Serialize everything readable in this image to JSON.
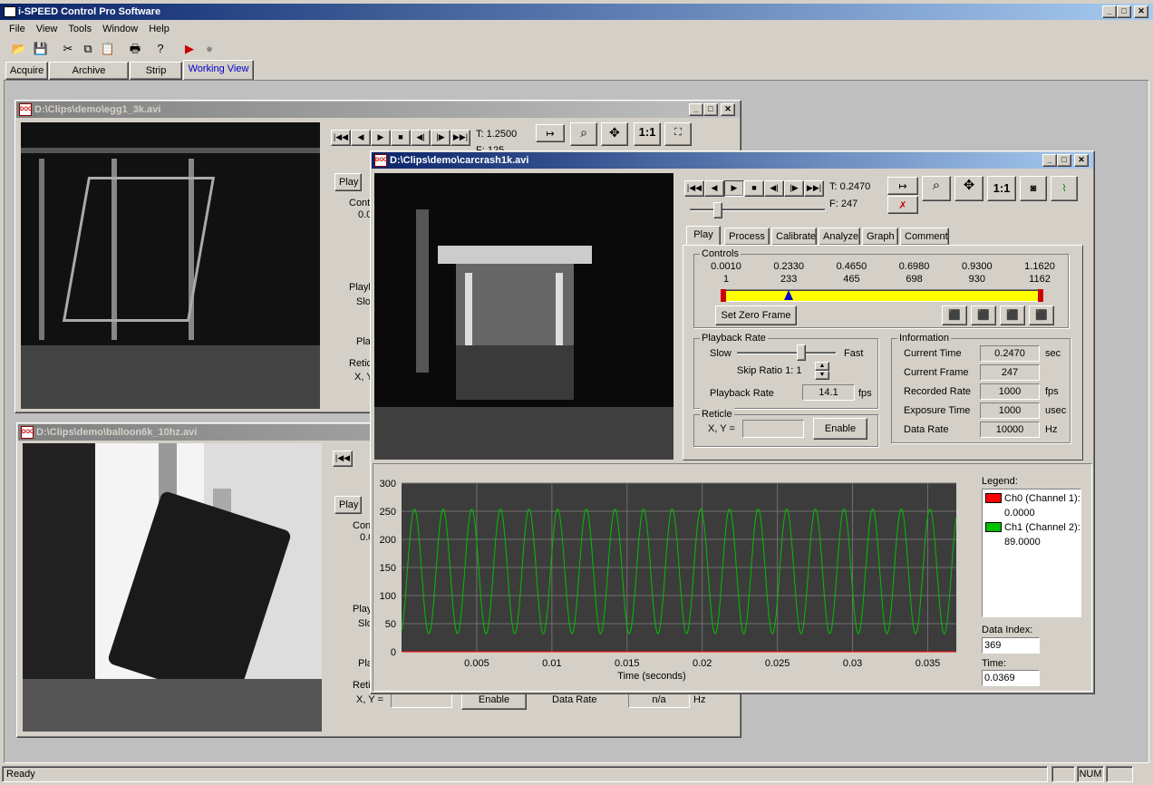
{
  "app": {
    "title": "i-SPEED Control Pro Software",
    "status": "Ready",
    "num": "NUM"
  },
  "menu": [
    "File",
    "View",
    "Tools",
    "Window",
    "Help"
  ],
  "tabs": [
    "Acquire",
    "Archive Browser",
    "Strip View",
    "Working View"
  ],
  "win_egg": {
    "title": "D:\\Clips\\demo\\egg1_3k.avi",
    "t": "T: 1.2500",
    "f": "F: 125",
    "tab": "Play",
    "cont": "Cont",
    "cval": "0.0",
    "playb": "Playb",
    "slov": "Slov",
    "play2": "Play",
    "retic": "Retic",
    "xy": "X, Y"
  },
  "win_balloon": {
    "title": "D:\\Clips\\demo\\balloon6k_10hz.avi",
    "tab": "Play",
    "cont": "Con",
    "cval": "0.0",
    "playb": "Play",
    "slo": "Slo",
    "pla": "Pla",
    "reti": "Reti",
    "xy": "X, Y =",
    "enable": "Enable",
    "data_rate_label": "Data Rate",
    "data_rate_value": "n/a",
    "data_rate_unit": "Hz"
  },
  "win_car": {
    "title": "D:\\Clips\\demo\\carcrash1k.avi",
    "t": "T: 0.2470",
    "f": "F: 247",
    "zoom": "1:1",
    "tabs": [
      "Play",
      "Process",
      "Calibrate",
      "Analyze",
      "Graph",
      "Comment"
    ],
    "controls": {
      "label": "Controls",
      "times": [
        "0.0010",
        "0.2330",
        "0.4650",
        "0.6980",
        "0.9300",
        "1.1620"
      ],
      "frames": [
        "1",
        "233",
        "465",
        "698",
        "930",
        "1162"
      ],
      "zero": "Set Zero Frame",
      "position": 0.2
    },
    "playback": {
      "label": "Playback Rate",
      "slow": "Slow",
      "fast": "Fast",
      "skip": "Skip Ratio  1: 1",
      "rate_label": "Playback Rate",
      "rate": "14.1",
      "unit": "fps"
    },
    "reticle": {
      "label": "Reticle",
      "xy": "X, Y =",
      "enable": "Enable"
    },
    "info": {
      "label": "Information",
      "rows": [
        {
          "label": "Current Time",
          "value": "0.2470",
          "unit": "sec"
        },
        {
          "label": "Current Frame",
          "value": "247",
          "unit": ""
        },
        {
          "label": "Recorded Rate",
          "value": "1000",
          "unit": "fps"
        },
        {
          "label": "Exposure Time",
          "value": "1000",
          "unit": "usec"
        },
        {
          "label": "Data Rate",
          "value": "10000",
          "unit": "Hz"
        }
      ]
    },
    "legend": {
      "label": "Legend:",
      "ch0": "Ch0 (Channel 1):",
      "ch0v": "0.0000",
      "ch1": "Ch1 (Channel 2):",
      "ch1v": "89.0000",
      "c0": "#ff0000",
      "c1": "#00c000"
    },
    "data_index_label": "Data Index:",
    "data_index": "369",
    "time_label": "Time:",
    "time": "0.0369"
  },
  "chart_data": {
    "type": "line",
    "xlabel": "Time (seconds)",
    "ylim": [
      0,
      300
    ],
    "xlim": [
      0,
      0.0369
    ],
    "yticks": [
      0,
      50,
      100,
      150,
      200,
      250,
      300
    ],
    "xticks": [
      0.005,
      0.01,
      0.015,
      0.02,
      0.025,
      0.03,
      0.035
    ],
    "xtick_labels": [
      "0.005",
      "0.01",
      "0.015",
      "0.02",
      "0.025",
      "0.03",
      "0.035"
    ],
    "series": [
      {
        "color": "#00c000",
        "shape": "sine",
        "amplitude": 111,
        "offset": 143,
        "frequency_hz": 525
      },
      {
        "color": "#ff0000",
        "shape": "flat",
        "value": 0
      }
    ],
    "grid": true
  }
}
